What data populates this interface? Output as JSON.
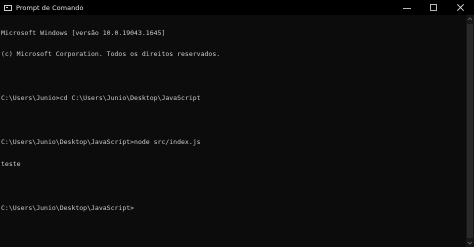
{
  "window": {
    "title": "Prompt de Comando"
  },
  "console": {
    "lines": [
      "Microsoft Windows [versão 10.0.19043.1645]",
      "(c) Microsoft Corporation. Todos os direitos reservados.",
      "",
      "C:\\Users\\Junio>cd C:\\Users\\Junio\\Desktop\\JavaScript",
      "",
      "C:\\Users\\Junio\\Desktop\\JavaScript>node src/index.js",
      "teste",
      "",
      "C:\\Users\\Junio\\Desktop\\JavaScript>"
    ]
  },
  "icons": {
    "app": "console-icon",
    "minimize": "minimize-icon",
    "maximize": "maximize-icon",
    "close": "close-icon",
    "scroll_up": "chevron-up-icon",
    "scroll_down": "chevron-down-icon"
  },
  "colors": {
    "background": "#0c0c0c",
    "titlebar": "#000000",
    "text": "#cccccc"
  }
}
